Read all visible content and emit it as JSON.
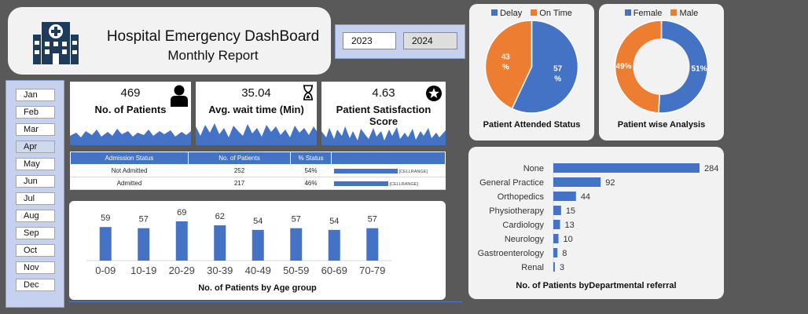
{
  "header": {
    "title": "Hospital Emergency DashBoard",
    "subtitle": "Monthly Report"
  },
  "years": [
    "2023",
    "2024"
  ],
  "months": [
    "Jan",
    "Feb",
    "Mar",
    "Apr",
    "May",
    "Jun",
    "Jul",
    "Aug",
    "Sep",
    "Oct",
    "Nov",
    "Dec"
  ],
  "selected_month": "Apr",
  "kpis": {
    "patients": {
      "value": "469",
      "label": "No. of Patients",
      "icon": "person-icon"
    },
    "wait": {
      "value": "35.04",
      "label": "Avg. wait time (Min)",
      "icon": "hourglass-icon"
    },
    "satisfaction": {
      "value": "4.63",
      "label": "Patient Satisfaction Score",
      "icon": "star-badge-icon"
    }
  },
  "admission": {
    "headers": [
      "Admission Status",
      "No. of Patients",
      "% Status",
      ""
    ],
    "rows": [
      {
        "status": "Not Admitted",
        "count": "252",
        "pct": "54%",
        "fraction": 0.54,
        "range": "[CELLRANGE]"
      },
      {
        "status": "Admitted",
        "count": "217",
        "pct": "46%",
        "fraction": 0.46,
        "range": "[CELLRANGE]"
      }
    ]
  },
  "colors": {
    "blue": "#4472c4",
    "orange": "#ed7d31"
  },
  "chart_data": [
    {
      "type": "bar",
      "title": "No. of Patients by Age group",
      "categories": [
        "0-09",
        "10-19",
        "20-29",
        "30-39",
        "40-49",
        "50-59",
        "60-69",
        "70-79"
      ],
      "values": [
        59,
        57,
        69,
        62,
        54,
        57,
        54,
        57
      ],
      "ylim": [
        0,
        80
      ]
    },
    {
      "type": "pie",
      "title": "Patient Attended Status",
      "series": [
        {
          "name": "Delay",
          "value": 57,
          "label": "57 %",
          "color": "#4472c4"
        },
        {
          "name": "On Time",
          "value": 43,
          "label": "43 %",
          "color": "#ed7d31"
        }
      ]
    },
    {
      "type": "pie",
      "donut": true,
      "title": "Patient wise Analysis",
      "series": [
        {
          "name": "Female",
          "value": 51,
          "label": "51%",
          "color": "#4472c4"
        },
        {
          "name": "Male",
          "value": 49,
          "label": "49%",
          "color": "#ed7d31"
        }
      ]
    },
    {
      "type": "bar",
      "orientation": "horizontal",
      "title": "No. of Patients byDepartmental referral",
      "categories": [
        "None",
        "General Practice",
        "Orthopedics",
        "Physiotherapy",
        "Cardiology",
        "Neurology",
        "Gastroenterology",
        "Renal"
      ],
      "values": [
        284,
        92,
        44,
        15,
        13,
        10,
        8,
        3
      ]
    }
  ]
}
